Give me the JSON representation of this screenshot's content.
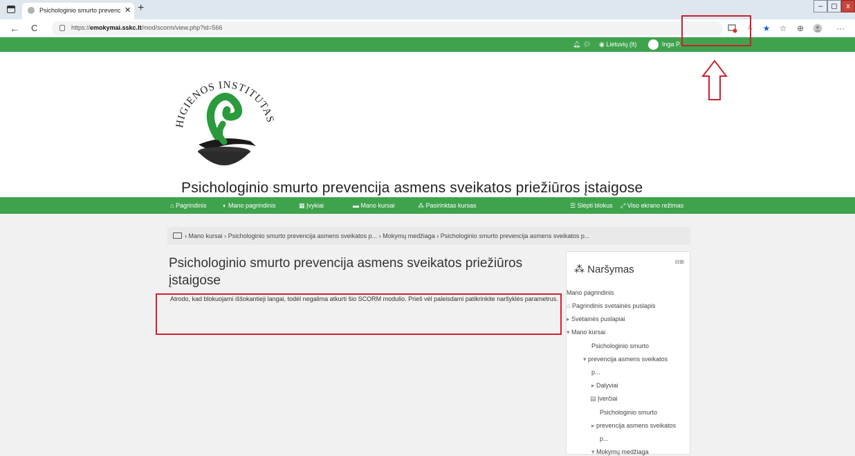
{
  "browser": {
    "tab_title": "Psichologinio smurto prevencija",
    "tab_close": "✕",
    "new_tab": "+",
    "url_prefix": "https://",
    "url_domain": "emokymai.sskc.lt",
    "url_path": "/mod/scorm/view.php?id=566",
    "back": "←",
    "reload": "C",
    "more": "···",
    "win_min": "‒",
    "win_max": "◻",
    "win_close": "x"
  },
  "topnav": {
    "language": "Lietuvių (lt)",
    "user": "Inga P."
  },
  "logo": {
    "text_top": "INSTITUTAS",
    "text_left": "HIGIENOS"
  },
  "site": {
    "title": "Psichologinio smurto prevencija asmens sveikatos priežiūros įstaigose"
  },
  "mainnav": {
    "home": "Pagrindinis",
    "dashboard": "Mano pagrindinis",
    "events": "Įvykiai",
    "my_courses": "Mano kursai",
    "selected_course": "Pasirinktas kursas",
    "hide_blocks": "Slėpti blokus",
    "fullscreen": "Viso ekrano režimas"
  },
  "breadcrumb": {
    "items": [
      "Mano kursai",
      "Psichologinio smurto prevencija asmens sveikatos p...",
      "Mokymų medžiaga",
      "Psichologinio smurto prevencija asmens sveikatos p..."
    ],
    "sep": "›"
  },
  "content": {
    "heading": "Psichologinio smurto prevencija asmens sveikatos priežiūros įstaigose",
    "message": "Atrodo, kad blokuojami iššokantieji langai, todėl negalima atkurti šio SCORM modulio. Prieš vėl paleisdami patikrinkite naršyklės parametrus."
  },
  "nav_block": {
    "title": "Naršymas",
    "items": {
      "dashboard": "Mano pagrindinis",
      "site_home": "Pagrindinis svetainės puslapis",
      "site_pages": "Svetainės puslapiai",
      "my_courses": "Mano kursai",
      "course_line1": "Psichologinio smurto",
      "course_line2": "prevencija asmens sveikatos",
      "course_line3": "p...",
      "participants": "Dalyviai",
      "grades": "Įverčiai",
      "sub_line1": "Psichologinio smurto",
      "sub_line2": "prevencija asmens sveikatos",
      "sub_line3": "p...",
      "materials": "Mokymų medžiaga"
    }
  },
  "colors": {
    "brand_green": "#3fa34d",
    "annotation_red": "#c8202e"
  }
}
